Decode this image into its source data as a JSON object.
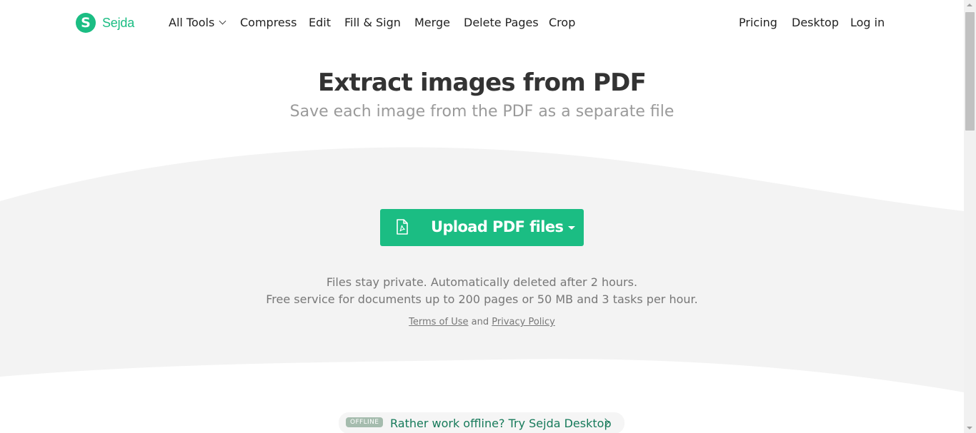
{
  "brand": {
    "logo_letter": "S",
    "name": "Sejda",
    "color": "#1bbd83"
  },
  "nav": {
    "all_tools": "All Tools",
    "compress": "Compress",
    "edit": "Edit",
    "fill_sign": "Fill & Sign",
    "merge": "Merge",
    "delete_pages": "Delete Pages",
    "crop": "Crop",
    "pricing": "Pricing",
    "desktop": "Desktop",
    "login": "Log in"
  },
  "hero": {
    "title": "Extract images from PDF",
    "subtitle": "Save each image from the PDF as a separate file"
  },
  "upload": {
    "label": "Upload PDF files",
    "icon": "pdf-file-icon"
  },
  "info": {
    "line1": "Files stay private. Automatically deleted after 2 hours.",
    "line2": "Free service for documents up to 200 pages or 50 MB and 3 tasks per hour.",
    "terms": "Terms of Use",
    "and": "and",
    "privacy": "Privacy Policy"
  },
  "offline": {
    "badge": "OFFLINE",
    "text": "Rather work offline? Try Sejda Desktop"
  },
  "colors": {
    "accent": "#1bbd83",
    "band": "#f3f3f3",
    "offline_text": "#167a5a"
  }
}
